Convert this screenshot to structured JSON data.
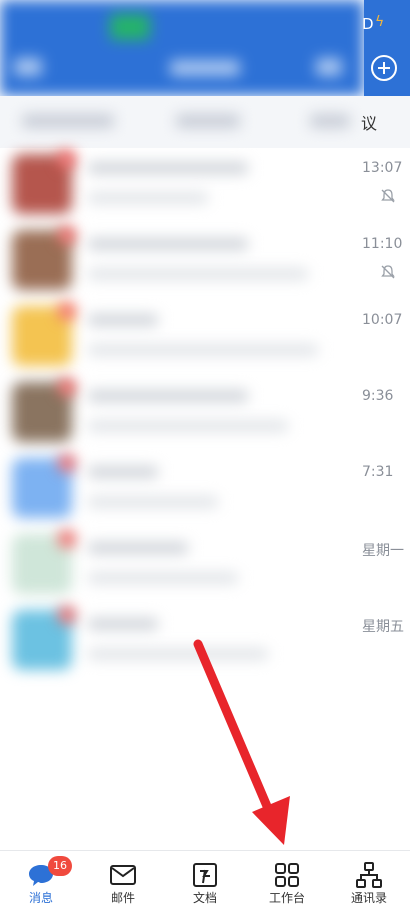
{
  "header": {
    "status_time_partial": "D",
    "add_button": "+"
  },
  "filter": {
    "right_label": "议"
  },
  "messages": [
    {
      "time": "13:07",
      "muted": true
    },
    {
      "time": "11:10",
      "muted": true
    },
    {
      "time": "10:07",
      "muted": false
    },
    {
      "time": "9:36",
      "muted": false
    },
    {
      "time": "7:31",
      "muted": false
    },
    {
      "time": "星期一",
      "muted": false
    },
    {
      "time": "星期五",
      "muted": false
    }
  ],
  "bottom_nav": {
    "items": [
      {
        "label": "消息",
        "icon": "chat-bubble-icon",
        "active": true,
        "badge": "16"
      },
      {
        "label": "邮件",
        "icon": "mail-icon",
        "active": false
      },
      {
        "label": "文档",
        "icon": "document-icon",
        "active": false
      },
      {
        "label": "工作台",
        "icon": "grid-apps-icon",
        "active": false
      },
      {
        "label": "通讯录",
        "icon": "contacts-icon",
        "active": false
      }
    ]
  },
  "annotation": {
    "arrow_color": "#e8252b"
  },
  "colors": {
    "brand_blue": "#2d71d6",
    "badge_red": "#f04a3e"
  }
}
